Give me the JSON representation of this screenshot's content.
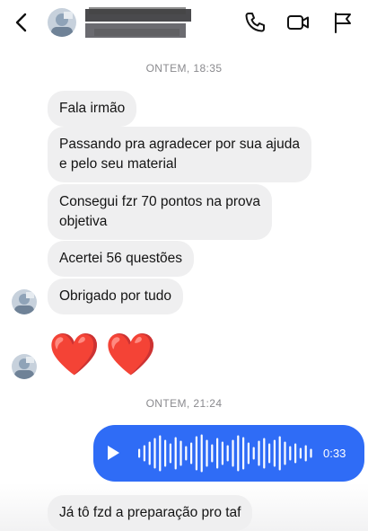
{
  "header": {
    "back_icon": "chevron-left-icon",
    "contact_name": "",
    "actions": [
      "phone-icon",
      "video-camera-icon",
      "flag-icon"
    ]
  },
  "dividers": [
    "ONTEM, 18:35",
    "ONTEM, 21:24"
  ],
  "messages": [
    {
      "line1": "Fala irmão",
      "line2": ""
    },
    {
      "line1": "Passando pra agradecer por sua ajuda",
      "line2": "e pelo seu material"
    },
    {
      "line1": "Consegui fzr 70 pontos na prova",
      "line2": "objetiva"
    },
    {
      "line1": "Acertei 56 questões",
      "line2": ""
    },
    {
      "line1": "Obrigado por tudo",
      "line2": ""
    }
  ],
  "reaction": "❤️❤️",
  "voice_message": {
    "duration": "0:33",
    "color": "#2f6cf6"
  },
  "last_message": "Já tô fzd a preparação pro taf",
  "colors": {
    "bubble": "#efeff0",
    "sent": "#2f6cf6",
    "heart": "#e8232f"
  }
}
